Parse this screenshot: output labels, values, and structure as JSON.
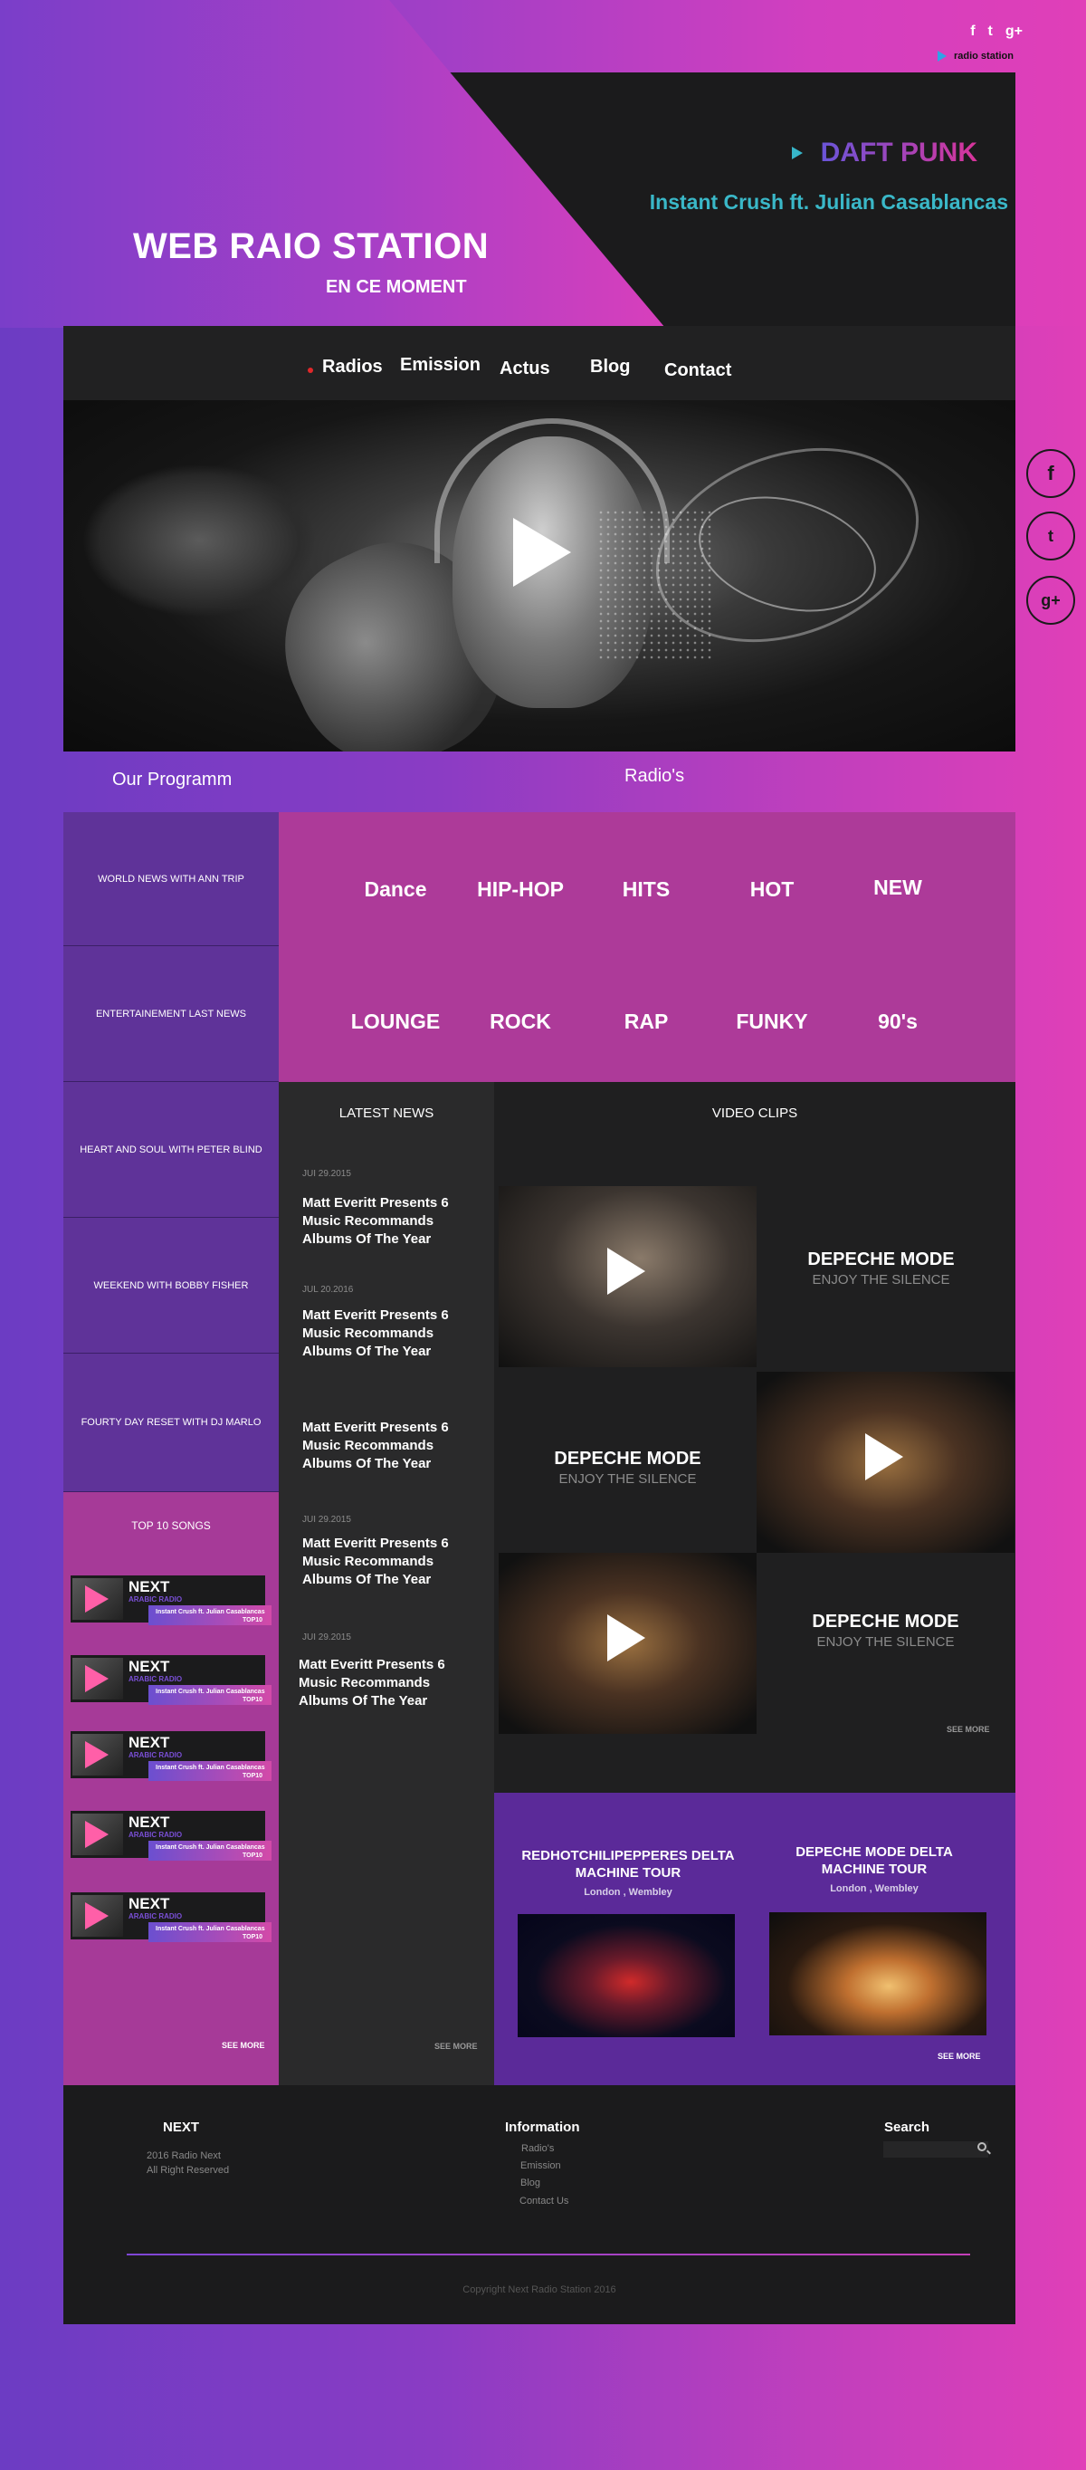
{
  "header": {
    "social": [
      "f",
      "t",
      "g+"
    ],
    "radio_station_label": "radio station",
    "site_title": "WEB RAIO STATION",
    "site_subtitle": "EN CE MOMENT",
    "now_playing": {
      "artist": "DAFT PUNK",
      "song": "Instant Crush ft. Julian Casablancas"
    }
  },
  "nav": [
    "Radios",
    "Emission",
    "Actus",
    "Blog",
    "Contact"
  ],
  "side_social": [
    "f",
    "t",
    "g+"
  ],
  "sections": {
    "program": "Our Programm",
    "radios": "Radio's"
  },
  "programs": [
    "WORLD NEWS WITH ANN TRIP",
    "ENTERTAINEMENT LAST NEWS",
    "HEART AND SOUL WITH PETER BLIND",
    "WEEKEND WITH BOBBY FISHER",
    "FOURTY DAY RESET WITH DJ MARLO"
  ],
  "genres": [
    "Dance",
    "HIP-HOP",
    "HITS",
    "HOT",
    "NEW",
    "LOUNGE",
    "ROCK",
    "RAP",
    "FUNKY",
    "90's"
  ],
  "news": {
    "heading": "LATEST NEWS",
    "items": [
      {
        "date": "JUI 29.2015",
        "title": "Matt Everitt Presents 6 Music Recommands Albums Of The Year"
      },
      {
        "date": "JUL 20.2016",
        "title": "Matt Everitt Presents 6 Music Recommands Albums Of The Year"
      },
      {
        "date": "",
        "title": "Matt Everitt Presents 6 Music Recommands Albums Of The Year"
      },
      {
        "date": "JUI 29.2015",
        "title": "Matt Everitt Presents 6 Music Recommands Albums Of The Year"
      },
      {
        "date": "JUI 29.2015",
        "title": "Matt Everitt Presents 6 Music Recommands Albums Of The Year"
      }
    ],
    "see_more": "SEE MORE"
  },
  "clips": {
    "heading": "VIDEO CLIPS",
    "items": [
      {
        "title": "DEPECHE MODE",
        "sub": "ENJOY THE SILENCE"
      },
      {
        "title": "DEPECHE MODE",
        "sub": "ENJOY THE SILENCE"
      },
      {
        "title": "DEPECHE MODE",
        "sub": "ENJOY THE SILENCE"
      }
    ],
    "see_more": "SEE MORE"
  },
  "tours": [
    {
      "title": "REDHOTCHILIPEPPERES DELTA MACHINE TOUR",
      "location": "London , Wembley"
    },
    {
      "title": "DEPECHE MODE DELTA MACHINE TOUR",
      "location": "London , Wembley"
    }
  ],
  "tours_see_more": "SEE MORE",
  "top_songs": {
    "heading": "TOP 10 SONGS",
    "items": [
      {
        "next": "NEXT",
        "label": "ARABIC RADIO",
        "song": "Instant Crush ft. Julian Casablancas",
        "rank": "TOP10"
      },
      {
        "next": "NEXT",
        "label": "ARABIC RADIO",
        "song": "Instant Crush ft. Julian Casablancas",
        "rank": "TOP10"
      },
      {
        "next": "NEXT",
        "label": "ARABIC RADIO",
        "song": "Instant Crush ft. Julian Casablancas",
        "rank": "TOP10"
      },
      {
        "next": "NEXT",
        "label": "ARABIC RADIO",
        "song": "Instant Crush ft. Julian Casablancas",
        "rank": "TOP10"
      },
      {
        "next": "NEXT",
        "label": "ARABIC RADIO",
        "song": "Instant Crush ft. Julian Casablancas",
        "rank": "TOP10"
      }
    ],
    "see_more": "SEE MORE"
  },
  "footer": {
    "brand": "NEXT",
    "brand_line1": "2016 Radio Next",
    "brand_line2": "All Right Reserved",
    "info_heading": "Information",
    "info_links": [
      "Radio's",
      "Emission",
      "Blog",
      "Contact Us"
    ],
    "search_heading": "Search",
    "copyright": "Copyright Next Radio Station 2016"
  }
}
